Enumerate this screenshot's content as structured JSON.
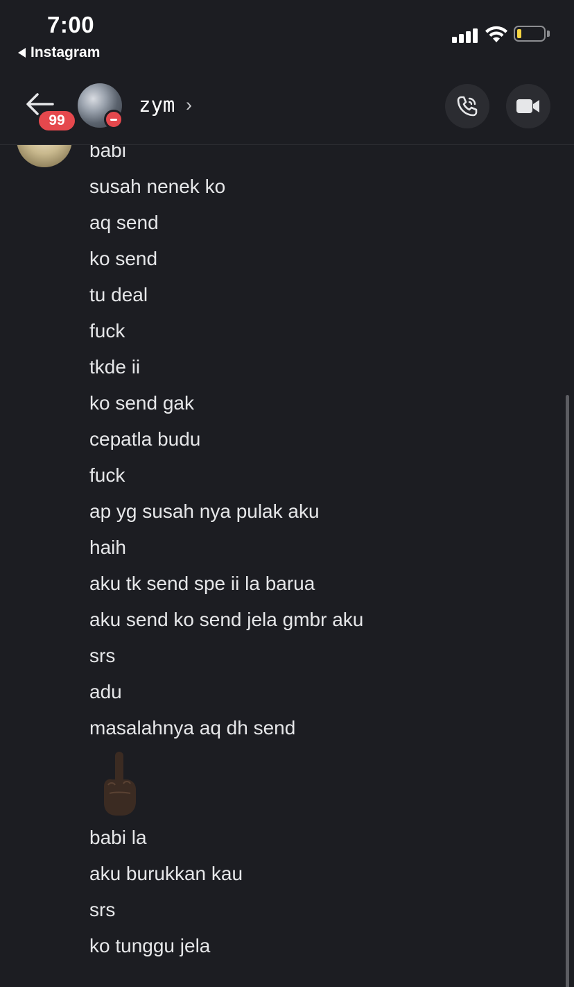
{
  "status_bar": {
    "time": "7:00",
    "back_app_label": "Instagram",
    "battery_color": "#f5d442"
  },
  "header": {
    "back_icon": "arrow-left-icon",
    "unread_badge": "99",
    "username": "zym",
    "chevron": "›",
    "status_color": "#e5484d",
    "call_icon": "phone-icon",
    "video_icon": "video-camera-icon"
  },
  "messages": [
    "babi",
    "susah nenek ko",
    "aq send",
    "ko send",
    "tu deal",
    "fuck",
    "tkde ii",
    "ko send gak",
    "cepatla budu",
    "fuck",
    "ap yg susah nya pulak aku",
    "haih",
    "aku tk send spe ii la barua",
    "aku send ko send jela gmbr aku",
    "srs",
    "adu",
    "masalahnya aq dh send",
    "babi la",
    "aku burukkan kau",
    "srs",
    "ko tunggu jela"
  ],
  "emoji_message": "middle-finger-emoji"
}
